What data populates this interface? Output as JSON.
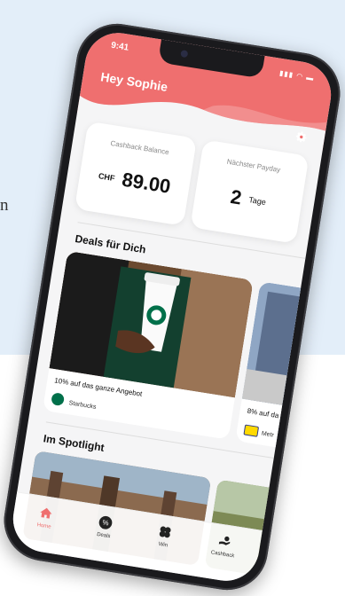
{
  "background": {
    "letter": "n"
  },
  "status_bar": {
    "time": "9:41",
    "icons": "signal-wifi-battery"
  },
  "header": {
    "greeting": "Hey Sophie",
    "color": "#ef6f6f"
  },
  "cashback_card": {
    "label": "Cashback Balance",
    "currency": "CHF",
    "amount": "89.00"
  },
  "payday_card": {
    "label": "Nächster Payday",
    "days": "2",
    "unit": "Tage"
  },
  "deals": {
    "title": "Deals für Dich",
    "items": [
      {
        "text": "10% auf das ganze Angebot",
        "brand": "Starbucks",
        "logo": "starbucks-logo"
      },
      {
        "text": "8% auf da",
        "brand": "Metr",
        "logo": "metro-logo"
      }
    ]
  },
  "spotlight": {
    "title": "Im Spotlight"
  },
  "bottom_nav": {
    "items": [
      {
        "label": "Home",
        "icon": "home-icon",
        "active": true
      },
      {
        "label": "Deals",
        "icon": "percent-icon",
        "active": false
      },
      {
        "label": "Win",
        "icon": "clover-icon",
        "active": false
      },
      {
        "label": "Cashback",
        "icon": "cashback-icon",
        "active": false
      }
    ]
  },
  "colors": {
    "accent": "#ef6f6f",
    "starbucks": "#00704a"
  }
}
